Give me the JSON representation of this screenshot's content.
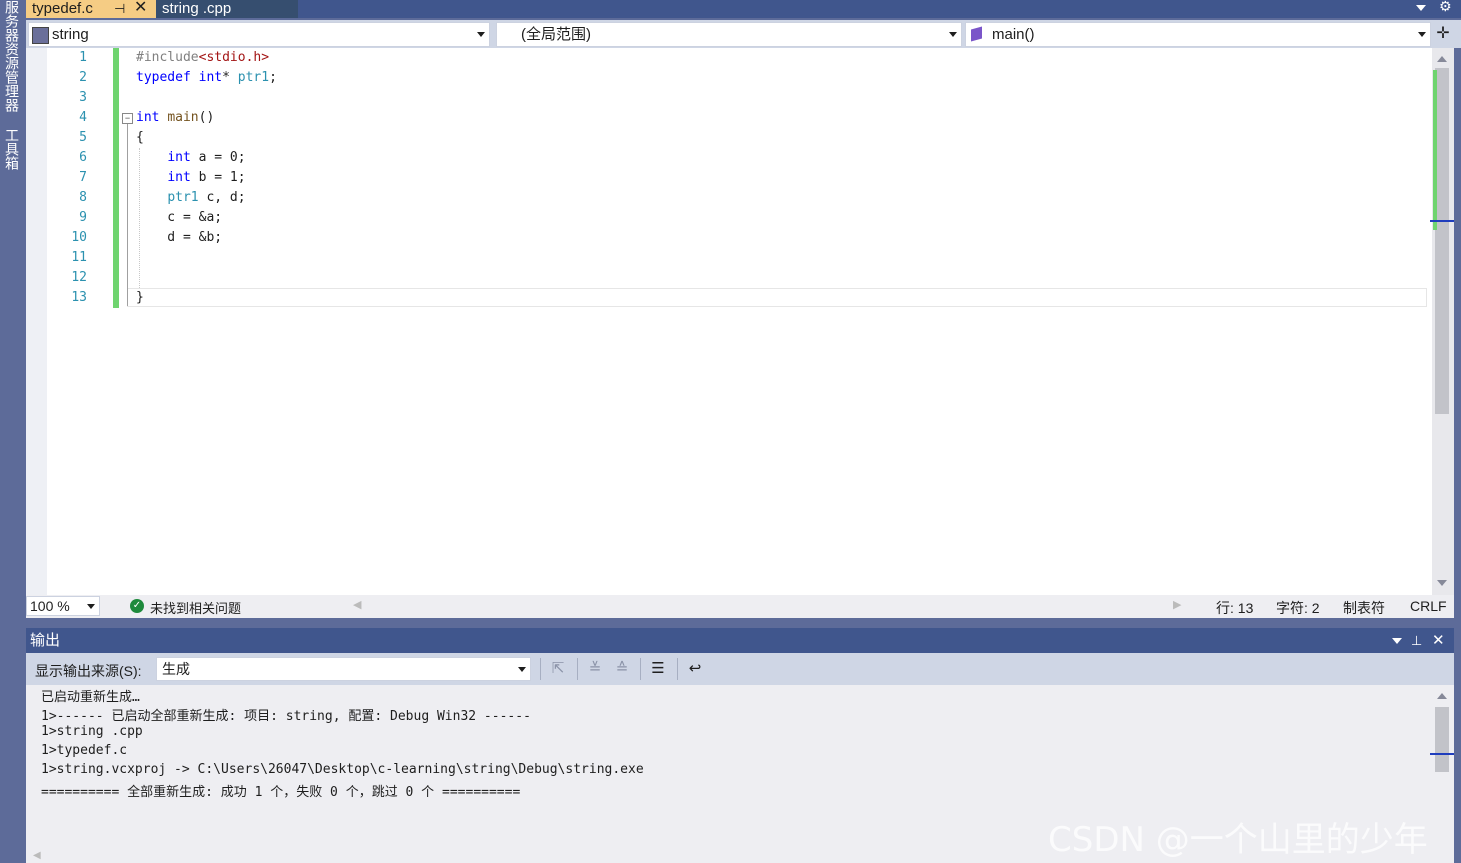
{
  "side_strip": {
    "item1": "服务器资源管理器",
    "item2": "工具箱"
  },
  "tabs": [
    {
      "label": "typedef.c",
      "active": true
    },
    {
      "label": "string .cpp",
      "active": false
    }
  ],
  "navbar": {
    "project": "string",
    "scope": "(全局范围)",
    "member": "main()"
  },
  "editor": {
    "line_numbers": [
      "1",
      "2",
      "3",
      "4",
      "5",
      "6",
      "7",
      "8",
      "9",
      "10",
      "11",
      "12",
      "13"
    ],
    "lines": [
      {
        "n": 1,
        "parts": [
          [
            "pp",
            "#include"
          ],
          [
            "str",
            "<stdio.h>"
          ]
        ]
      },
      {
        "n": 2,
        "parts": [
          [
            "kw",
            "typedef "
          ],
          [
            "kw",
            "int"
          ],
          [
            "",
            "* "
          ],
          [
            "ty",
            "ptr1"
          ],
          [
            "",
            ";"
          ]
        ]
      },
      {
        "n": 3,
        "parts": []
      },
      {
        "n": 4,
        "parts": [
          [
            "kw",
            "int "
          ],
          [
            "fn",
            "main"
          ],
          [
            "",
            "()"
          ]
        ]
      },
      {
        "n": 5,
        "parts": [
          [
            "",
            "{"
          ]
        ]
      },
      {
        "n": 6,
        "parts": [
          [
            "",
            "    "
          ],
          [
            "kw",
            "int "
          ],
          [
            "",
            "a = 0;"
          ]
        ]
      },
      {
        "n": 7,
        "parts": [
          [
            "",
            "    "
          ],
          [
            "kw",
            "int "
          ],
          [
            "",
            "b = 1;"
          ]
        ]
      },
      {
        "n": 8,
        "parts": [
          [
            "",
            "    "
          ],
          [
            "ty",
            "ptr1"
          ],
          [
            "",
            " c, d;"
          ]
        ]
      },
      {
        "n": 9,
        "parts": [
          [
            "",
            "    c = &a;"
          ]
        ]
      },
      {
        "n": 10,
        "parts": [
          [
            "",
            "    d = &b;"
          ]
        ]
      },
      {
        "n": 11,
        "parts": []
      },
      {
        "n": 12,
        "parts": []
      },
      {
        "n": 13,
        "parts": [
          [
            "",
            "}"
          ]
        ]
      }
    ]
  },
  "status": {
    "zoom": "100 %",
    "issues": "未找到相关问题",
    "line": "行: 13",
    "char": "字符: 2",
    "tabs": "制表符",
    "eol": "CRLF"
  },
  "output": {
    "title": "输出",
    "source_label": "显示输出来源(S):",
    "source_value": "生成",
    "lines": [
      "已启动重新生成…",
      "1>------ 已启动全部重新生成: 项目: string, 配置: Debug Win32 ------",
      "1>string .cpp",
      "1>typedef.c",
      "1>string.vcxproj -> C:\\Users\\26047\\Desktop\\c-learning\\string\\Debug\\string.exe",
      "========== 全部重新生成: 成功 1 个，失败 0 个，跳过 0 个 =========="
    ]
  },
  "watermark": "CSDN @一个山里的少年",
  "colors": {
    "accent_tab": "#f5cc84",
    "chrome": "#40568d",
    "change_bar": "#6fd46f"
  }
}
